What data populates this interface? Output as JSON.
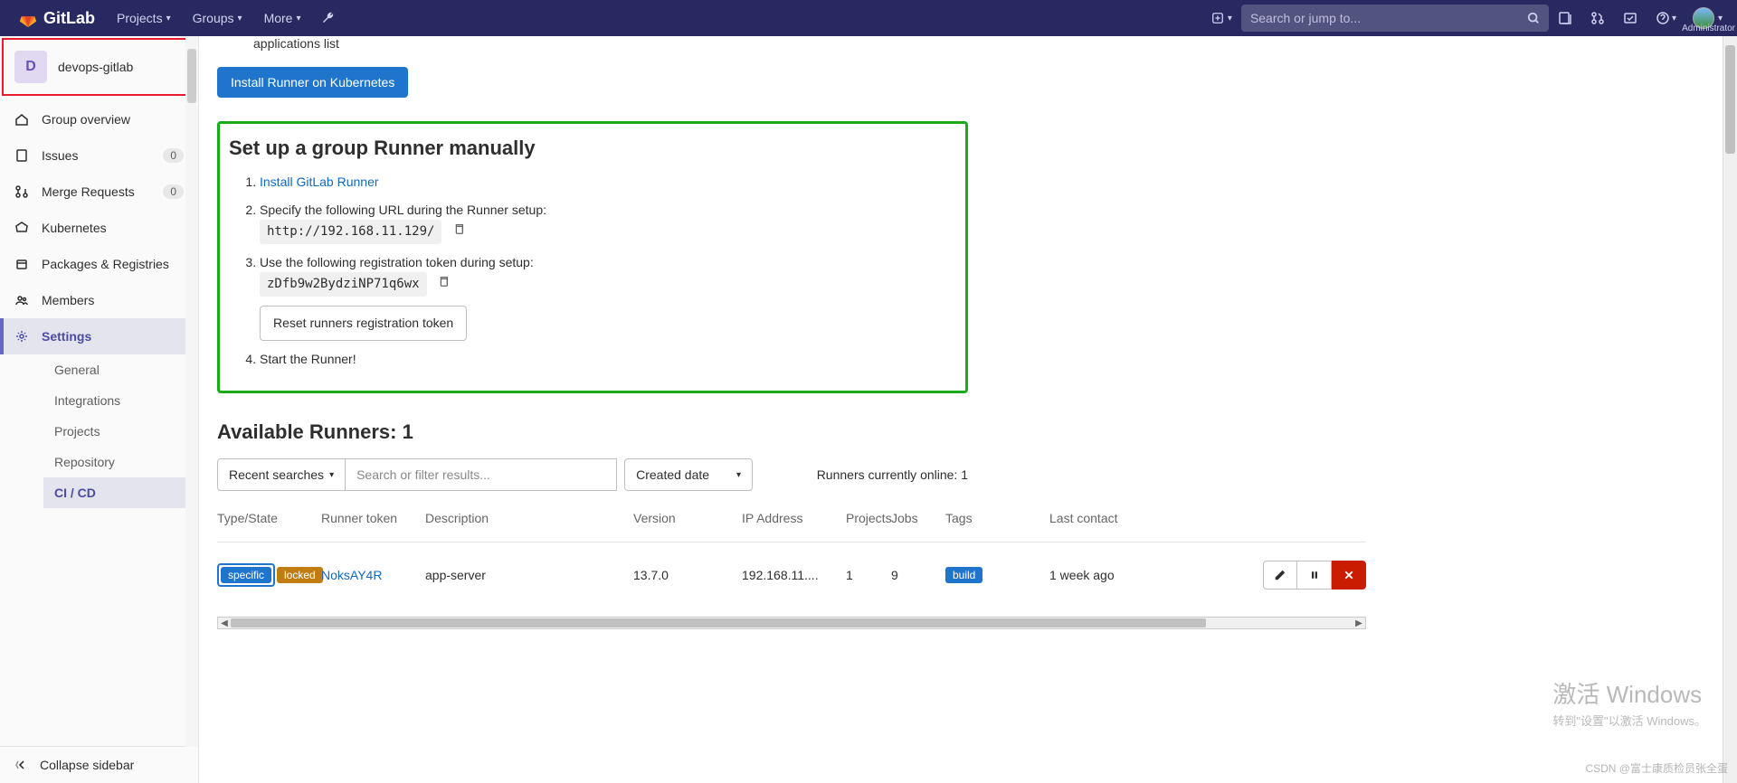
{
  "topnav": {
    "brand": "GitLab",
    "items": [
      "Projects",
      "Groups",
      "More"
    ],
    "search_placeholder": "Search or jump to...",
    "user_label": "Administrator"
  },
  "sidebar": {
    "project_initial": "D",
    "project_name": "devops-gitlab",
    "items": [
      {
        "label": "Group overview"
      },
      {
        "label": "Issues",
        "badge": "0"
      },
      {
        "label": "Merge Requests",
        "badge": "0"
      },
      {
        "label": "Kubernetes"
      },
      {
        "label": "Packages & Registries"
      },
      {
        "label": "Members"
      },
      {
        "label": "Settings"
      }
    ],
    "subitems": [
      "General",
      "Integrations",
      "Projects",
      "Repository",
      "CI / CD"
    ],
    "collapse": "Collapse sidebar"
  },
  "main": {
    "app_list_text": "applications list",
    "install_btn": "Install Runner on Kubernetes",
    "setup_title": "Set up a group Runner manually",
    "step1_link": "Install GitLab Runner",
    "step2_text": "Specify the following URL during the Runner setup:",
    "step2_url": "http://192.168.11.129/",
    "step3_text": "Use the following registration token during setup:",
    "step3_token": "zDfb9w2BydziNP71q6wx",
    "reset_btn": "Reset runners registration token",
    "step4_text": "Start the Runner!",
    "available_title": "Available Runners: 1",
    "recent_searches": "Recent searches",
    "filter_placeholder": "Search or filter results...",
    "sort_label": "Created date",
    "online_text": "Runners currently online: 1",
    "headers": {
      "type": "Type/State",
      "token": "Runner token",
      "desc": "Description",
      "ver": "Version",
      "ip": "IP Address",
      "proj": "Projects",
      "jobs": "Jobs",
      "tags": "Tags",
      "contact": "Last contact"
    },
    "row": {
      "tag_specific": "specific",
      "tag_locked": "locked",
      "token": "NoksAY4R",
      "desc": "app-server",
      "ver": "13.7.0",
      "ip": "192.168.11....",
      "proj": "1",
      "jobs": "9",
      "tag_build": "build",
      "contact": "1 week ago"
    }
  },
  "watermark": {
    "l1": "激活 Windows",
    "l2": "转到\"设置\"以激活 Windows。",
    "csdn": "CSDN @富士康质检员张全蛋"
  }
}
